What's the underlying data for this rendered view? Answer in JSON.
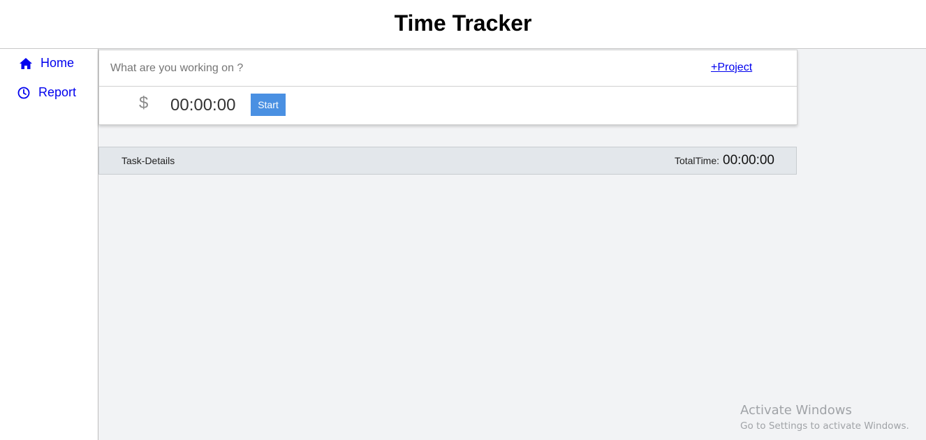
{
  "app": {
    "title": "Time Tracker"
  },
  "sidebar": {
    "items": [
      {
        "label": "Home",
        "icon": "home-icon"
      },
      {
        "label": "Report",
        "icon": "clock-icon"
      }
    ]
  },
  "entry": {
    "placeholder": "What are you working on ?",
    "value": "",
    "project_link": "+Project",
    "billable_symbol": "$",
    "timer": "00:00:00",
    "start_label": "Start"
  },
  "task_bar": {
    "label": "Task-Details",
    "total_label": "TotalTime:",
    "total_value": "00:00:00"
  },
  "watermark": {
    "title": "Activate Windows",
    "subtitle": "Go to Settings to activate Windows."
  },
  "colors": {
    "link": "#0000ee",
    "accent": "#4a90e2",
    "main_bg": "#f2f3f5",
    "task_bar_bg": "#e3e7eb"
  }
}
